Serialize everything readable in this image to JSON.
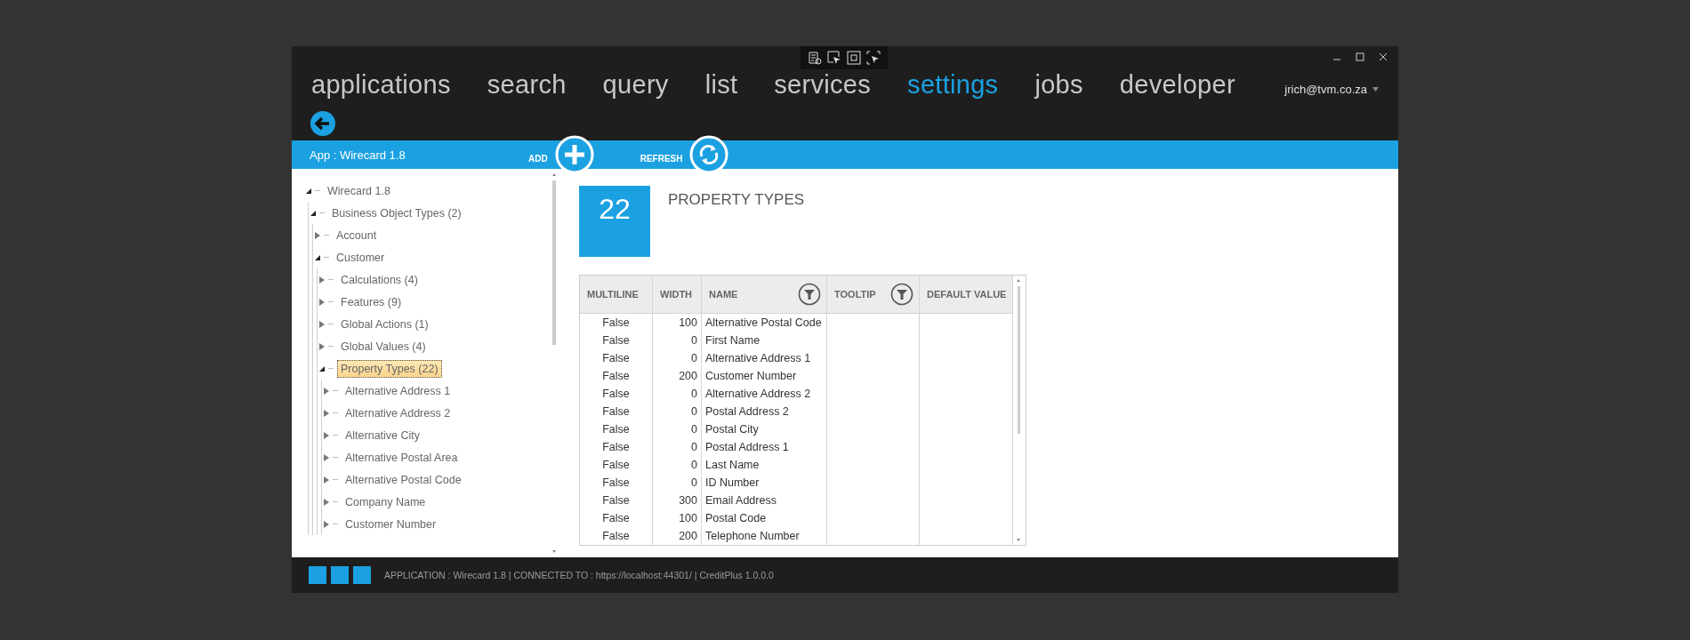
{
  "window": {
    "user": "jrich@tvm.co.za"
  },
  "nav": [
    {
      "label": "applications",
      "selected": false
    },
    {
      "label": "search",
      "selected": false
    },
    {
      "label": "query",
      "selected": false
    },
    {
      "label": "list",
      "selected": false
    },
    {
      "label": "services",
      "selected": false
    },
    {
      "label": "settings",
      "selected": true
    },
    {
      "label": "jobs",
      "selected": false
    },
    {
      "label": "developer",
      "selected": false
    }
  ],
  "toolbar": {
    "title": "App : Wirecard 1.8",
    "buttons": [
      {
        "label": "ADD",
        "kind": "add"
      },
      {
        "label": "REFRESH",
        "kind": "refresh"
      }
    ]
  },
  "tree": [
    {
      "label": "Wirecard 1.8",
      "expanded": true,
      "selected": false,
      "children": [
        {
          "label": "Business Object Types (2)",
          "expanded": true,
          "selected": false,
          "children": [
            {
              "label": "Account",
              "expanded": false,
              "selected": false
            },
            {
              "label": "Customer",
              "expanded": true,
              "selected": false,
              "children": [
                {
                  "label": "Calculations (4)",
                  "expanded": false,
                  "selected": false
                },
                {
                  "label": "Features (9)",
                  "expanded": false,
                  "selected": false
                },
                {
                  "label": "Global Actions (1)",
                  "expanded": false,
                  "selected": false
                },
                {
                  "label": "Global Values (4)",
                  "expanded": false,
                  "selected": false
                },
                {
                  "label": "Property Types (22)",
                  "expanded": true,
                  "selected": true,
                  "children": [
                    {
                      "label": "Alternative Address 1",
                      "expanded": false,
                      "selected": false
                    },
                    {
                      "label": "Alternative Address 2",
                      "expanded": false,
                      "selected": false
                    },
                    {
                      "label": "Alternative City",
                      "expanded": false,
                      "selected": false
                    },
                    {
                      "label": "Alternative Postal Area",
                      "expanded": false,
                      "selected": false
                    },
                    {
                      "label": "Alternative Postal Code",
                      "expanded": false,
                      "selected": false
                    },
                    {
                      "label": "Company Name",
                      "expanded": false,
                      "selected": false
                    },
                    {
                      "label": "Customer Number",
                      "expanded": false,
                      "selected": false
                    }
                  ]
                }
              ]
            }
          ]
        }
      ]
    }
  ],
  "summary": {
    "count": "22",
    "title": "PROPERTY TYPES"
  },
  "table": {
    "columns": [
      {
        "label": "MULTILINE",
        "filter": false
      },
      {
        "label": "WIDTH",
        "filter": false
      },
      {
        "label": "NAME",
        "filter": true
      },
      {
        "label": "TOOLTIP",
        "filter": true
      },
      {
        "label": "DEFAULT VALUE",
        "filter": false
      }
    ],
    "rows": [
      [
        "False",
        "100",
        "Alternative Postal Code"
      ],
      [
        "False",
        "0",
        "First Name"
      ],
      [
        "False",
        "0",
        "Alternative Address 1"
      ],
      [
        "False",
        "200",
        "Customer Number"
      ],
      [
        "False",
        "0",
        "Alternative Address 2"
      ],
      [
        "False",
        "0",
        "Postal Address 2"
      ],
      [
        "False",
        "0",
        "Postal City"
      ],
      [
        "False",
        "0",
        "Postal Address 1"
      ],
      [
        "False",
        "0",
        "Last Name"
      ],
      [
        "False",
        "0",
        "ID Number"
      ],
      [
        "False",
        "300",
        "Email Address"
      ],
      [
        "False",
        "100",
        "Postal Code"
      ],
      [
        "False",
        "200",
        "Telephone Number"
      ]
    ]
  },
  "status_bar": "APPLICATION : Wirecard 1.8 | CONNECTED TO : https://localhost:44301/ | CreditPlus 1.0.0.0"
}
